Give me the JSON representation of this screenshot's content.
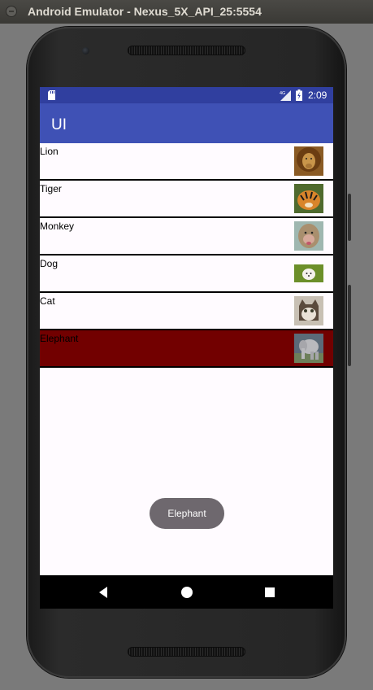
{
  "window": {
    "title": "Android Emulator - Nexus_5X_API_25:5554"
  },
  "status_bar": {
    "time": "2:09",
    "network_label": "4G"
  },
  "app_bar": {
    "title": "UI"
  },
  "animals": [
    {
      "name": "Lion",
      "image": "lion-photo",
      "selected": false
    },
    {
      "name": "Tiger",
      "image": "tiger-photo",
      "selected": false
    },
    {
      "name": "Monkey",
      "image": "monkey-photo",
      "selected": false
    },
    {
      "name": "Dog",
      "image": "dog-photo",
      "selected": false
    },
    {
      "name": "Cat",
      "image": "cat-photo",
      "selected": false
    },
    {
      "name": "Elephant",
      "image": "elephant-photo",
      "selected": true
    }
  ],
  "toast": {
    "text": "Elephant"
  },
  "colors": {
    "status_bar": "#303f9f",
    "app_bar": "#3f51b5",
    "selected_row": "#720000",
    "toast": "#6e686e"
  },
  "icons": [
    "sd-card-icon",
    "signal-icon",
    "battery-icon",
    "back-icon",
    "home-icon",
    "recents-icon"
  ]
}
